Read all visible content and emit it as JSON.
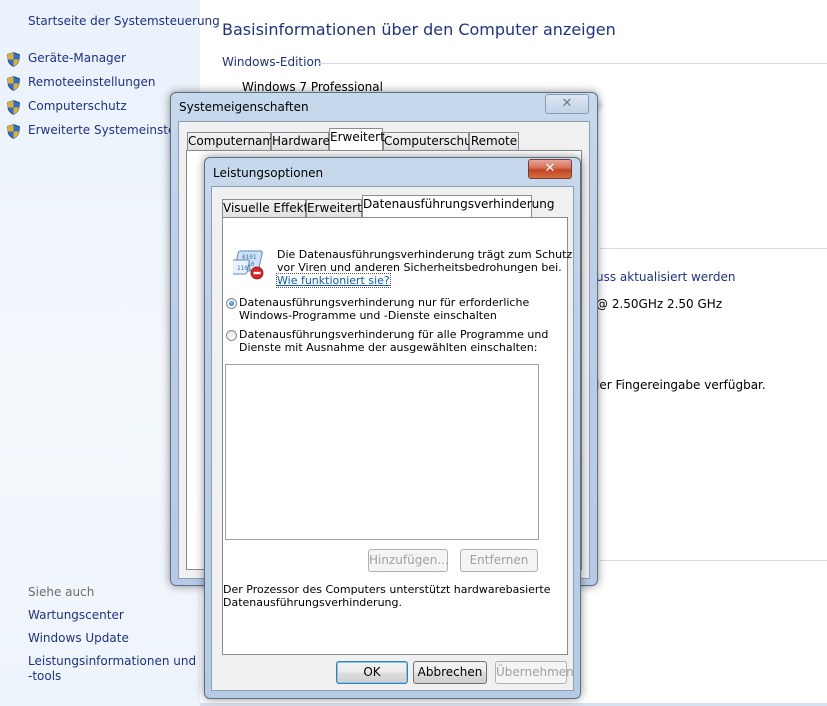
{
  "sidebar": {
    "home_link": "Startseite der Systemsteuerung",
    "tasks": [
      {
        "label": "Geräte-Manager",
        "icon": "shield-icon"
      },
      {
        "label": "Remoteeinstellungen",
        "icon": "shield-icon"
      },
      {
        "label": "Computerschutz",
        "icon": "shield-icon"
      },
      {
        "label": "Erweiterte Systemeinstellungen",
        "icon": "shield-icon"
      }
    ],
    "see_also_header": "Siehe auch",
    "see_also": [
      {
        "label": "Wartungscenter"
      },
      {
        "label": "Windows Update"
      },
      {
        "label": "Leistungsinformationen und"
      },
      {
        "label": "-tools"
      }
    ]
  },
  "main": {
    "title": "Basisinformationen über den Computer anzeigen",
    "edition_header": "Windows-Edition",
    "edition_value": "Windows 7 Professional",
    "update_link_fragment": "uss aktualisiert werden",
    "processor_fragment": "@ 2.50GHz   2.50 GHz",
    "touch_fragment": "ler Fingereingabe verfügbar."
  },
  "system_properties": {
    "title": "Systemeigenschaften",
    "close_glyph": "✕",
    "tabs": [
      "Computername",
      "Hardware",
      "Erweitert",
      "Computerschutz",
      "Remote"
    ],
    "active_tab": "Erweitert"
  },
  "performance_options": {
    "title": "Leistungsoptionen",
    "close_glyph": "✕",
    "tabs": [
      "Visuelle Effekte",
      "Erweitert",
      "Datenausführungsverhinderung"
    ],
    "active_tab": "Datenausführungsverhinderung",
    "description_line1": "Die Datenausführungsverhinderung trägt zum Schutz",
    "description_line2": "vor Viren und anderen Sicherheitsbedrohungen bei.",
    "help_link": "Wie funktioniert sie?",
    "option1_line1": "Datenausführungsverhinderung nur für erforderliche",
    "option1_line2": "Windows-Programme und -Dienste einschalten",
    "option1_checked": true,
    "option2_line1": "Datenausführungsverhinderung für alle Programme und",
    "option2_line2": "Dienste mit Ausnahme der ausgewählten einschalten:",
    "option2_checked": false,
    "add_button": "Hinzufügen...",
    "remove_button": "Entfernen",
    "info_line1": "Der Prozessor des Computers unterstützt hardwarebasierte",
    "info_line2": "Datenausführungsverhinderung.",
    "ok_button": "OK",
    "cancel_button": "Abbrechen",
    "apply_button": "Übernehmen"
  },
  "colors": {
    "link": "#1e3287",
    "accent_close": "#c14424"
  }
}
